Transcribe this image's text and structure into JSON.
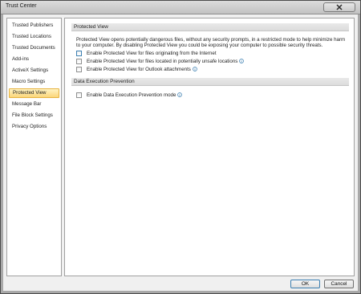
{
  "window": {
    "title": "Trust Center"
  },
  "sidebar": {
    "items": [
      {
        "label": "Trusted Publishers"
      },
      {
        "label": "Trusted Locations"
      },
      {
        "label": "Trusted Documents"
      },
      {
        "label": "Add-ins"
      },
      {
        "label": "ActiveX Settings"
      },
      {
        "label": "Macro Settings"
      },
      {
        "label": "Protected View",
        "selected": true
      },
      {
        "label": "Message Bar"
      },
      {
        "label": "File Block Settings"
      },
      {
        "label": "Privacy Options"
      }
    ]
  },
  "protected_view": {
    "header": "Protected View",
    "description": "Protected View opens potentially dangerous files, without any security prompts, in a restricted mode to help minimize harm to your computer. By disabling Protected View you could be exposing your computer to possible security threats.",
    "options": [
      {
        "label": "Enable Protected View for files originating from the Internet",
        "checked": false,
        "info": false
      },
      {
        "label": "Enable Protected View for files located in potentially unsafe locations",
        "checked": false,
        "info": true
      },
      {
        "label": "Enable Protected View for Outlook attachments",
        "checked": false,
        "info": true
      }
    ]
  },
  "dep": {
    "header": "Data Execution Prevention",
    "option": {
      "label": "Enable Data Execution Prevention mode",
      "checked": false,
      "info": true
    }
  },
  "buttons": {
    "ok": "OK",
    "cancel": "Cancel"
  },
  "colors": {
    "selected_bg": "#fbd67a",
    "info_icon": "#3c7fb1"
  }
}
